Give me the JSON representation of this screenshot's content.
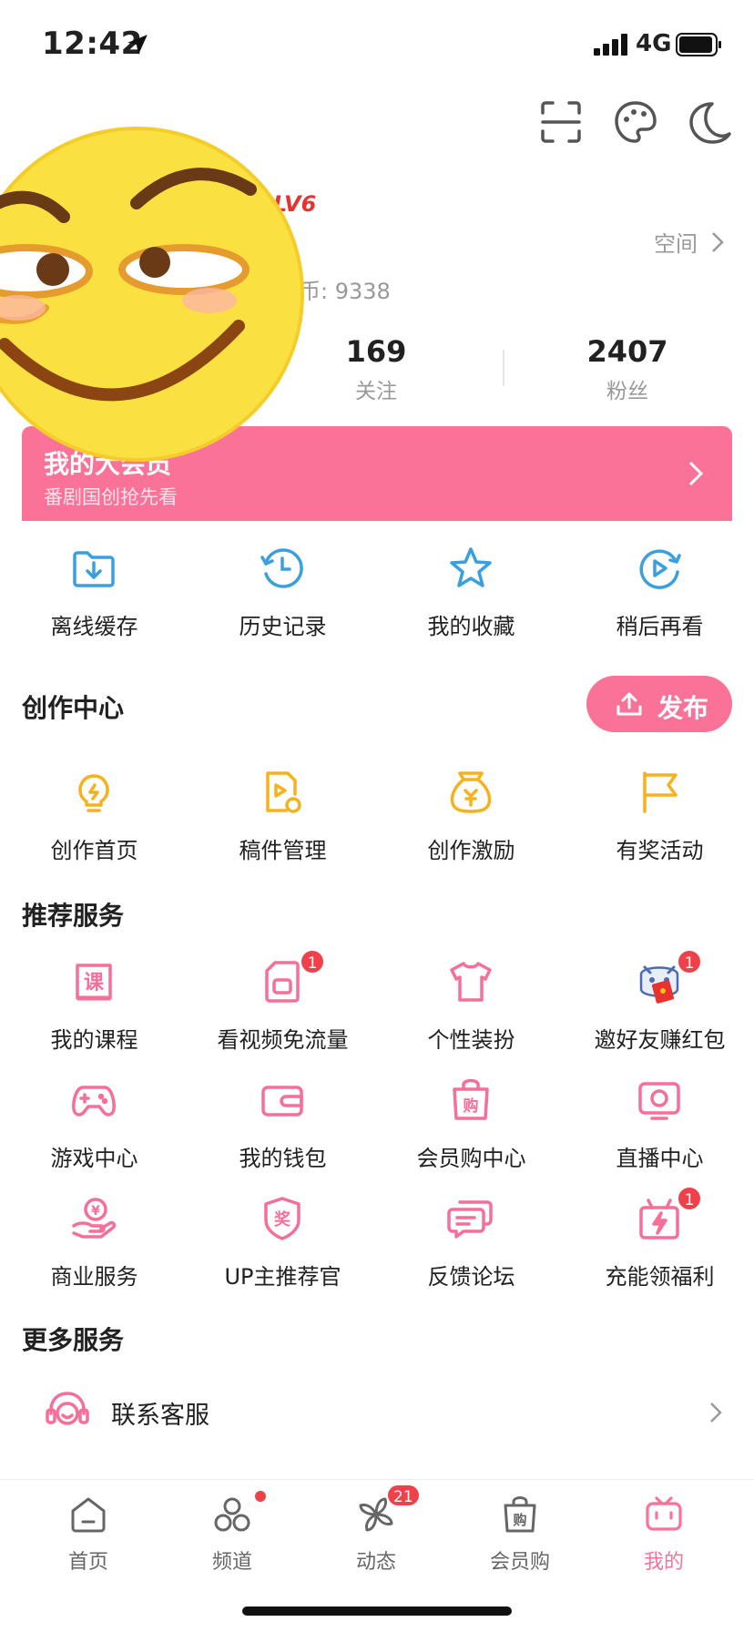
{
  "status_bar": {
    "time": "12:42",
    "network": "4G"
  },
  "header": {
    "icons": [
      "scan-icon",
      "palette-icon",
      "moon-icon"
    ]
  },
  "profile": {
    "level": "LV6",
    "space_label": "空间",
    "coins": "币: 9338",
    "stats": [
      {
        "value": "169",
        "label": "关注"
      },
      {
        "value": "2407",
        "label": "粉丝"
      }
    ]
  },
  "vip": {
    "title": "我的大会员",
    "subtitle": "番剧国创抢先看"
  },
  "quick": [
    {
      "label": "离线缓存",
      "icon": "download-folder-icon"
    },
    {
      "label": "历史记录",
      "icon": "history-clock-icon"
    },
    {
      "label": "我的收藏",
      "icon": "star-icon"
    },
    {
      "label": "稍后再看",
      "icon": "watch-later-icon"
    }
  ],
  "creation": {
    "title": "创作中心",
    "publish_label": "发布",
    "items": [
      {
        "label": "创作首页",
        "icon": "lightbulb-icon"
      },
      {
        "label": "稿件管理",
        "icon": "manuscript-icon"
      },
      {
        "label": "创作激励",
        "icon": "money-bag-icon"
      },
      {
        "label": "有奖活动",
        "icon": "flag-icon"
      }
    ]
  },
  "services": {
    "title": "推荐服务",
    "items": [
      {
        "label": "我的课程",
        "icon": "course-book-icon",
        "badge": ""
      },
      {
        "label": "看视频免流量",
        "icon": "sim-card-icon",
        "badge": "1"
      },
      {
        "label": "个性装扮",
        "icon": "tshirt-icon",
        "badge": ""
      },
      {
        "label": "邀好友赚红包",
        "icon": "invite-mascot-icon",
        "badge": "1"
      },
      {
        "label": "游戏中心",
        "icon": "gamepad-icon",
        "badge": ""
      },
      {
        "label": "我的钱包",
        "icon": "wallet-icon",
        "badge": ""
      },
      {
        "label": "会员购中心",
        "icon": "shopping-bag-icon",
        "badge": ""
      },
      {
        "label": "直播中心",
        "icon": "live-tv-icon",
        "badge": ""
      },
      {
        "label": "商业服务",
        "icon": "business-hand-icon",
        "badge": ""
      },
      {
        "label": "UP主推荐官",
        "icon": "award-badge-icon",
        "badge": ""
      },
      {
        "label": "反馈论坛",
        "icon": "chat-bubbles-icon",
        "badge": ""
      },
      {
        "label": "充能领福利",
        "icon": "gift-bolt-icon",
        "badge": "1"
      }
    ]
  },
  "more": {
    "title": "更多服务",
    "customer_service": "联系客服"
  },
  "tabs": [
    {
      "label": "首页",
      "icon": "home-icon"
    },
    {
      "label": "频道",
      "icon": "channel-icon"
    },
    {
      "label": "动态",
      "icon": "pinwheel-icon",
      "badge": "21"
    },
    {
      "label": "会员购",
      "icon": "shop-bag-icon"
    },
    {
      "label": "我的",
      "icon": "tv-mine-icon"
    }
  ],
  "colors": {
    "pink": "#fa7298",
    "blue": "#3a9fe0",
    "gold": "#f5b21d",
    "badge_red": "#f0414a"
  }
}
